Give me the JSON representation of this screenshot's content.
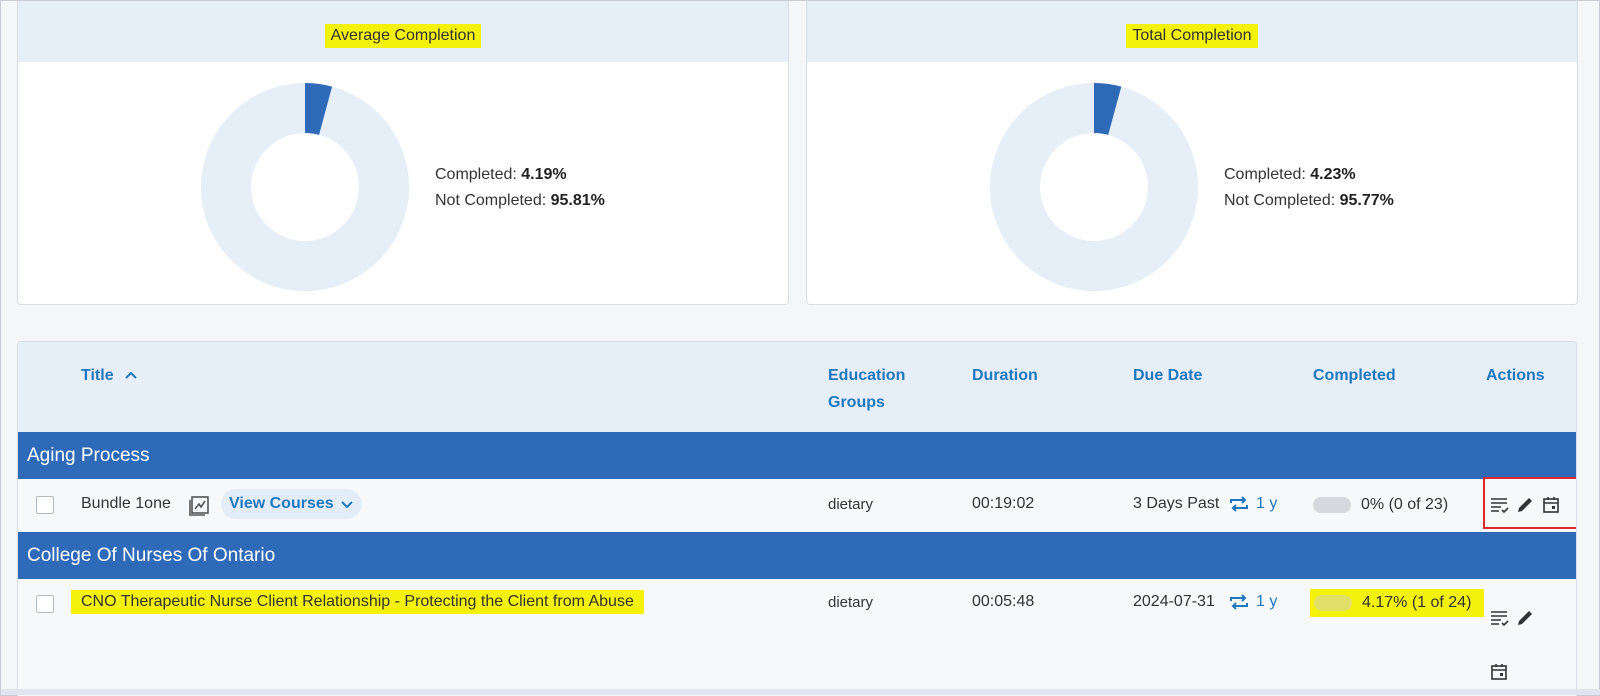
{
  "summary": {
    "average": {
      "title": "Average Completion",
      "completed_label": "Completed:",
      "completed_value": "4.19%",
      "not_completed_label": "Not Completed:",
      "not_completed_value": "95.81%",
      "completed_fraction": 0.0419
    },
    "total": {
      "title": "Total Completion",
      "completed_label": "Completed:",
      "completed_value": "4.23%",
      "not_completed_label": "Not Completed:",
      "not_completed_value": "95.77%",
      "completed_fraction": 0.0423
    },
    "colors": {
      "completed": "#2f6ab8",
      "not_completed": "#e6eef8"
    }
  },
  "table": {
    "columns": {
      "title": "Title",
      "education_groups_line1": "Education",
      "education_groups_line2": "Groups",
      "duration": "Duration",
      "due_date": "Due Date",
      "completed": "Completed",
      "actions": "Actions"
    },
    "groups": [
      {
        "name": "Aging Process",
        "rows": [
          {
            "title": "Bundle 1one",
            "view_courses": "View Courses",
            "education_group": "dietary",
            "duration": "00:19:02",
            "due_date": "3 Days Past",
            "recurrence": "1 y",
            "completed_text": "0% (0 of 23)",
            "completed_fraction": 0
          }
        ]
      },
      {
        "name": "College Of Nurses Of Ontario",
        "rows": [
          {
            "title": "CNO Therapeutic Nurse Client Relationship - Protecting the Client from Abuse",
            "education_group": "dietary",
            "duration": "00:05:48",
            "due_date": "2024-07-31",
            "recurrence": "1 y",
            "completed_text": "4.17% (1 of 24)",
            "completed_fraction": 0.0417
          }
        ]
      }
    ]
  }
}
